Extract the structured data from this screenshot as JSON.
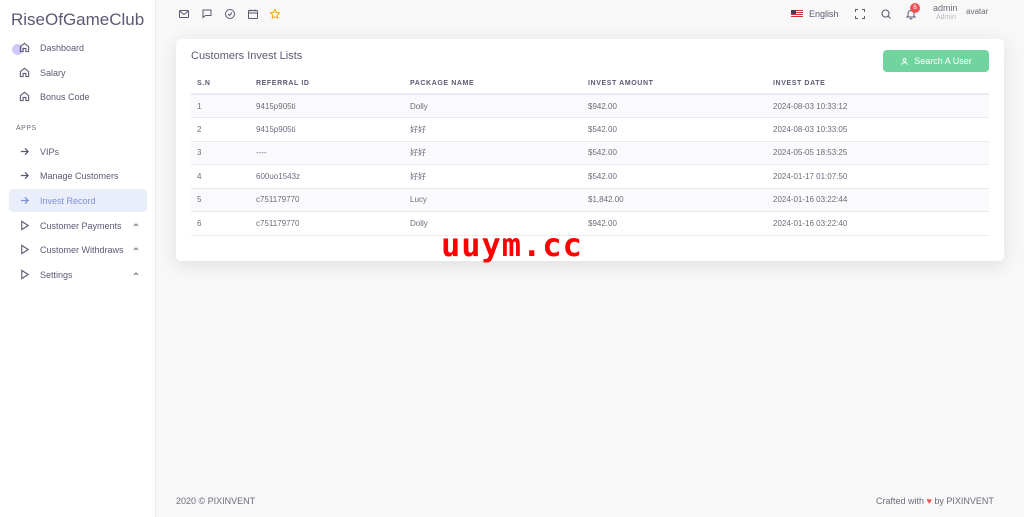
{
  "brand": {
    "name": "RiseOfGameClub"
  },
  "sidebar": {
    "section_label": "APPS",
    "items": [
      {
        "label": "Dashboard",
        "icon": "home-icon"
      },
      {
        "label": "Salary",
        "icon": "home-icon"
      },
      {
        "label": "Bonus Code",
        "icon": "home-icon"
      },
      {
        "label": "VIPs",
        "icon": "arrow-right-icon"
      },
      {
        "label": "Manage Customers",
        "icon": "arrow-right-icon"
      },
      {
        "label": "Invest Record",
        "icon": "arrow-right-icon",
        "active": true
      },
      {
        "label": "Customer Payments",
        "icon": "play-icon",
        "expandable": true
      },
      {
        "label": "Customer Withdraws",
        "icon": "play-icon",
        "expandable": true
      },
      {
        "label": "Settings",
        "icon": "play-icon",
        "expandable": true
      }
    ]
  },
  "header": {
    "language": "English",
    "notification_count": "6",
    "user_name": "admin",
    "user_role": "Admin",
    "avatar_alt": "avatar"
  },
  "card": {
    "title": "Customers Invest Lists",
    "search_button": "Search A User",
    "columns": [
      "S.N",
      "REFERRAL ID",
      "PACKAGE NAME",
      "INVEST AMOUNT",
      "INVEST DATE"
    ],
    "rows": [
      [
        "1",
        "9415p905ti",
        "Dolly",
        "$942.00",
        "2024-08-03 10:33:12"
      ],
      [
        "2",
        "9415p905ti",
        "好好",
        "$542.00",
        "2024-08-03 10:33:05"
      ],
      [
        "3",
        "----",
        "好好",
        "$542.00",
        "2024-05-05 18:53:25"
      ],
      [
        "4",
        "600uo1543z",
        "好好",
        "$542.00",
        "2024-01-17 01:07:50"
      ],
      [
        "5",
        "c751179770",
        "Lucy",
        "$1,842.00",
        "2024-01-16 03:22:44"
      ],
      [
        "6",
        "c751179770",
        "Dolly",
        "$942.00",
        "2024-01-16 03:22:40"
      ]
    ]
  },
  "watermark": "uuym.cc",
  "footer": {
    "copyright": "2020 © PIXINVENT",
    "crafted_prefix": "Crafted with",
    "crafted_suffix": "by PIXINVENT"
  },
  "colors": {
    "accent": "#7367f0",
    "active_bg": "#eaeefb",
    "success": "#71d49e",
    "danger": "#ea5455"
  }
}
